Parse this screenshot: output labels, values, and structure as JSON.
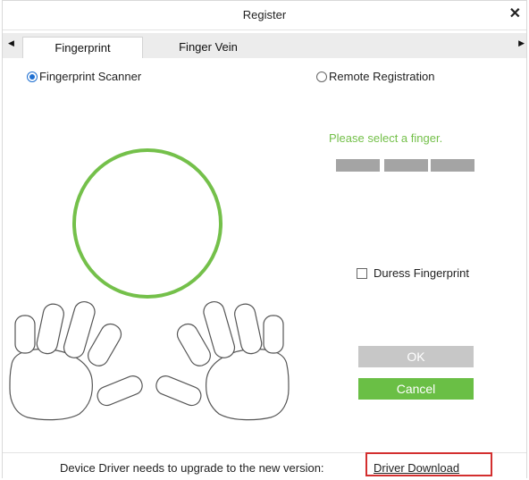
{
  "window": {
    "title": "Register",
    "close_symbol": "✕",
    "close_icon": "close-icon"
  },
  "tabs": {
    "left_arrow": "◀",
    "right_arrow": "▶",
    "items": [
      {
        "label": "Fingerprint",
        "active": true
      },
      {
        "label": "Finger Vein",
        "active": false
      }
    ]
  },
  "registration_mode": {
    "options": [
      {
        "label": "Fingerprint Scanner",
        "selected": true
      },
      {
        "label": "Remote Registration",
        "selected": false
      }
    ]
  },
  "scanner": {
    "prompt": "Please select a finger.",
    "progress_slots": 3,
    "accent_color": "#74c04a"
  },
  "duress": {
    "label": "Duress Fingerprint",
    "checked": false
  },
  "buttons": {
    "ok_label": "OK",
    "cancel_label": "Cancel"
  },
  "footer": {
    "message": "Device Driver needs to upgrade to the new version:",
    "link_label": "Driver Download"
  }
}
